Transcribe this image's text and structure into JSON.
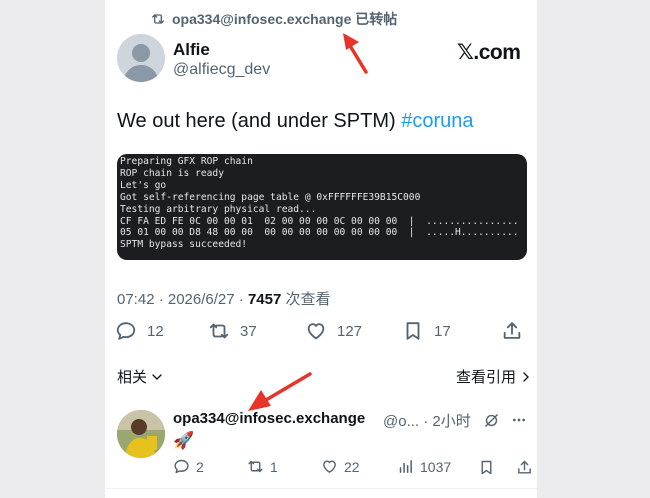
{
  "repost": {
    "text": "opa334@infosec.exchange 已转帖"
  },
  "author": {
    "name": "Alfie",
    "handle": "@alfiecg_dev"
  },
  "brand": {
    "logo_text": "𝕏.com"
  },
  "tweet": {
    "text": "We out here (and under SPTM) ",
    "hashtag": "#coruna"
  },
  "terminal": {
    "lines": [
      "Preparing GFX ROP chain",
      "ROP chain is ready",
      "Let's go",
      "Got self-referencing page table @ 0xFFFFFFE39B15C000",
      "Testing arbitrary physical read...",
      "CF FA ED FE 0C 00 00 01  02 00 00 00 0C 00 00 00  |  ................",
      "05 01 00 00 D8 48 00 00  00 00 00 00 00 00 00 00  |  .....H..........",
      "SPTM bypass succeeded!"
    ]
  },
  "meta": {
    "time": "07:42 · 2026/6/27 · ",
    "views": "7457",
    "views_label": " 次查看"
  },
  "actions": {
    "replies": "12",
    "reposts": "37",
    "likes": "127",
    "bookmarks": "17"
  },
  "related": {
    "label": "相关",
    "quotes_label": "查看引用"
  },
  "reply": {
    "name": "opa334@infosec.exchange",
    "handle": "@o... · 2小时",
    "emoji": "🚀",
    "replies": "2",
    "reposts": "1",
    "likes": "22",
    "views": "1037"
  },
  "colors": {
    "accent": "#1d9bf0",
    "muted": "#536471",
    "annotation_arrow": "#e8332a"
  }
}
